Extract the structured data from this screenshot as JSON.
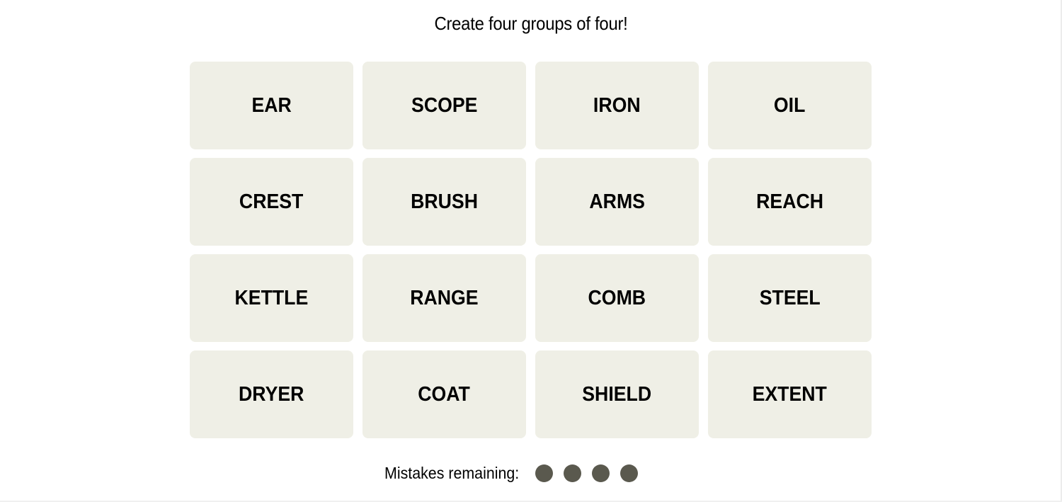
{
  "game": {
    "instruction": "Create four groups of four!",
    "tiles": [
      "EAR",
      "SCOPE",
      "IRON",
      "OIL",
      "CREST",
      "BRUSH",
      "ARMS",
      "REACH",
      "KETTLE",
      "RANGE",
      "COMB",
      "STEEL",
      "DRYER",
      "COAT",
      "SHIELD",
      "EXTENT"
    ],
    "mistakes_label": "Mistakes remaining:",
    "mistakes_remaining": 4,
    "mistakes_total": 4,
    "colors": {
      "tile_background": "#efefe6",
      "tile_text": "#000000",
      "mistake_dot": "#5a594e"
    }
  }
}
